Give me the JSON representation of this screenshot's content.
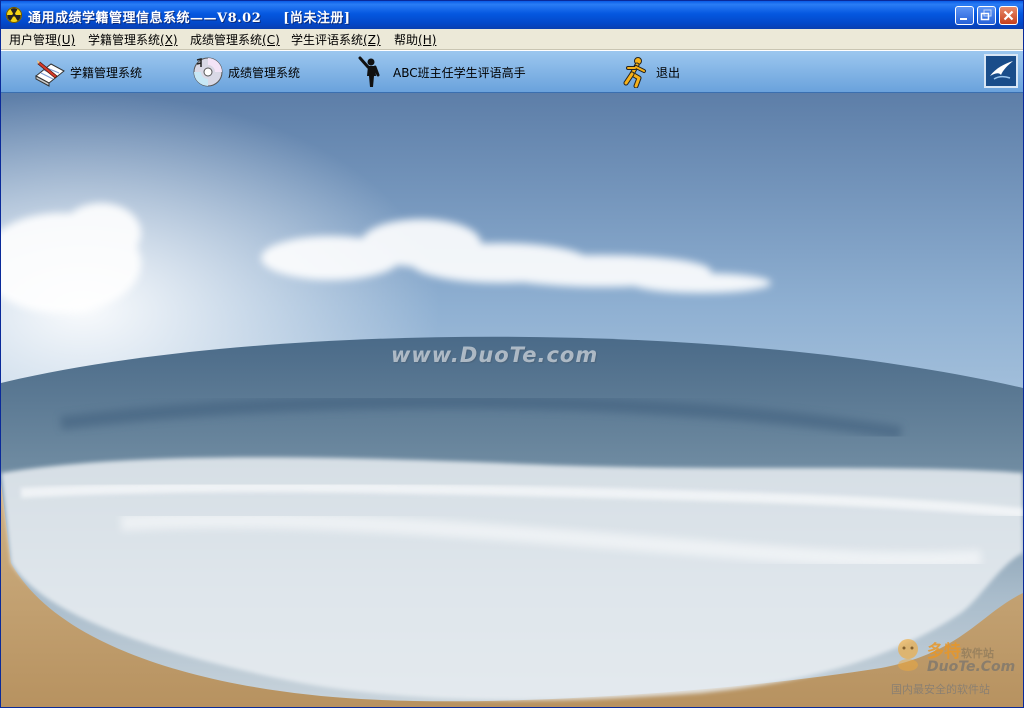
{
  "window": {
    "title": "通用成绩学籍管理信息系统——V8.02",
    "status": "[尚未注册]",
    "controls": {
      "minimize": "minimize",
      "maximize": "maximize",
      "close": "close"
    }
  },
  "menu": {
    "items": [
      {
        "label": "用户管理",
        "key": "(U)"
      },
      {
        "label": "学籍管理系统",
        "key": "(X)"
      },
      {
        "label": "成绩管理系统",
        "key": "(C)"
      },
      {
        "label": "学生评语系统",
        "key": "(Z)"
      },
      {
        "label": "帮助",
        "key": "(H)"
      }
    ]
  },
  "toolbar": {
    "items": [
      {
        "label": "学籍管理系统",
        "icon": "notebook-pencil-icon"
      },
      {
        "label": "成绩管理系统",
        "icon": "cd-disc-icon"
      },
      {
        "label": "ABC班主任学生评语高手",
        "icon": "waving-person-icon"
      },
      {
        "label": "退出",
        "icon": "running-man-icon"
      }
    ],
    "logo_icon": "bird-logo-icon"
  },
  "background": {
    "watermark": "www.DuoTe.com",
    "corner_brand": "多特",
    "corner_brand_suffix": "软件站",
    "corner_domain": "DuoTe.Com",
    "corner_slogan": "国内最安全的软件站"
  },
  "colors": {
    "titlebar": "#0558e0",
    "toolbar": "#8ab8e8",
    "menubar": "#ece9d8"
  }
}
